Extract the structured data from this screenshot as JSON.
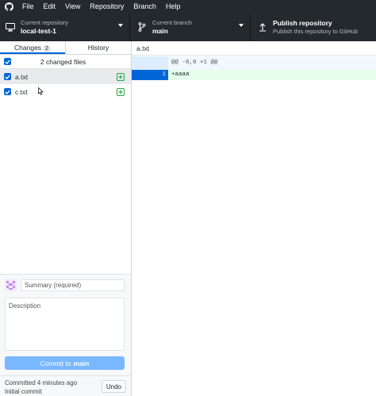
{
  "menubar": {
    "items": [
      "File",
      "Edit",
      "View",
      "Repository",
      "Branch",
      "Help"
    ]
  },
  "toolbar": {
    "repo": {
      "label": "Current repository",
      "value": "local-test-1"
    },
    "branch": {
      "label": "Current branch",
      "value": "main"
    },
    "publish": {
      "title": "Publish repository",
      "subtitle": "Publish this repository to GitHub"
    }
  },
  "tabs": {
    "changes_label": "Changes",
    "changes_count": "2",
    "history_label": "History"
  },
  "changes": {
    "summary": "2 changed files",
    "files": [
      {
        "name": "a.txt",
        "checked": true,
        "status": "added",
        "selected": true
      },
      {
        "name": "c.txt",
        "checked": true,
        "status": "added",
        "selected": false
      }
    ]
  },
  "commit": {
    "summary_placeholder": "Summary (required)",
    "description_placeholder": "Description",
    "button_prefix": "Commit to",
    "button_branch": "main"
  },
  "recent_commit": {
    "time": "Committed 4 minutes ago",
    "message": "Initial commit",
    "undo_label": "Undo"
  },
  "diff": {
    "filename": "a.txt",
    "hunk_header": "@@ -0,0 +1 @@",
    "lines": [
      {
        "new_line_number": "1",
        "text": "+aaaa"
      }
    ]
  },
  "colors": {
    "chrome_bg": "#24292e",
    "accent": "#0366d6",
    "added": "#28a745",
    "added_line_bg": "#e6ffed",
    "commit_button": "#79b8ff"
  }
}
